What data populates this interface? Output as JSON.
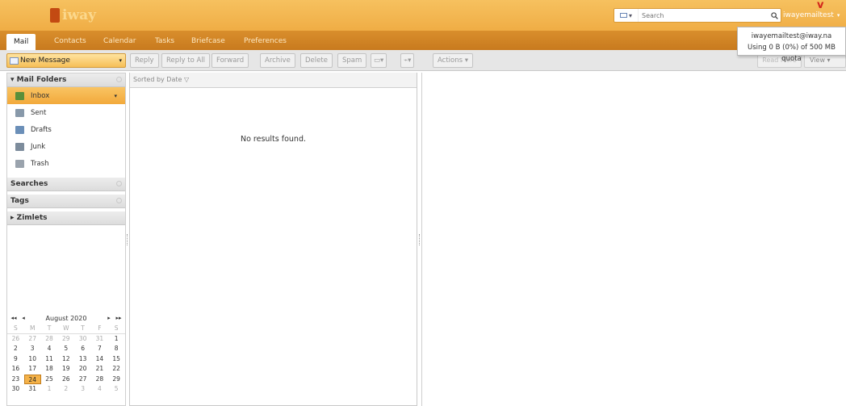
{
  "header": {
    "logo_text": "iway",
    "search": {
      "type_label": "▾",
      "placeholder": "Search"
    },
    "user": "iwayemailtest"
  },
  "user_popup": {
    "email": "iwayemailtest@iway.na",
    "quota": "Using 0 B (0%) of 500 MB quota"
  },
  "tabs": [
    "Mail",
    "Contacts",
    "Calendar",
    "Tasks",
    "Briefcase",
    "Preferences"
  ],
  "toolbar": {
    "new_message": "New Message",
    "reply": "Reply",
    "reply_all": "Reply to All",
    "forward": "Forward",
    "archive": "Archive",
    "delete": "Delete",
    "spam": "Spam",
    "actions": "Actions ▾",
    "read_more": "Read More",
    "view": "View ▾"
  },
  "sidebar": {
    "mail_folders": "Mail Folders",
    "folders": [
      {
        "label": "Inbox",
        "icon": "inbox-icon",
        "color": "#5a8f3a"
      },
      {
        "label": "Sent",
        "icon": "sent-icon",
        "color": "#8899aa"
      },
      {
        "label": "Drafts",
        "icon": "drafts-icon",
        "color": "#6b8fb8"
      },
      {
        "label": "Junk",
        "icon": "junk-icon",
        "color": "#7d8c9c"
      },
      {
        "label": "Trash",
        "icon": "trash-icon",
        "color": "#9aa3ad"
      }
    ],
    "searches": "Searches",
    "tags": "Tags",
    "zimlets": "Zimlets"
  },
  "calendar": {
    "title": "August 2020",
    "dow": [
      "S",
      "M",
      "T",
      "W",
      "T",
      "F",
      "S"
    ],
    "weeks": [
      [
        "26",
        "27",
        "28",
        "29",
        "30",
        "31",
        "1"
      ],
      [
        "2",
        "3",
        "4",
        "5",
        "6",
        "7",
        "8"
      ],
      [
        "9",
        "10",
        "11",
        "12",
        "13",
        "14",
        "15"
      ],
      [
        "16",
        "17",
        "18",
        "19",
        "20",
        "21",
        "22"
      ],
      [
        "23",
        "24",
        "25",
        "26",
        "27",
        "28",
        "29"
      ],
      [
        "30",
        "31",
        "1",
        "2",
        "3",
        "4",
        "5"
      ]
    ],
    "today": "24"
  },
  "list": {
    "sort_label": "Sorted by Date ▽",
    "empty": "No results found."
  },
  "colors": {
    "accent": "#f0ad45",
    "tab_bar": "#c87a1e",
    "selected": "#f2a93b"
  }
}
